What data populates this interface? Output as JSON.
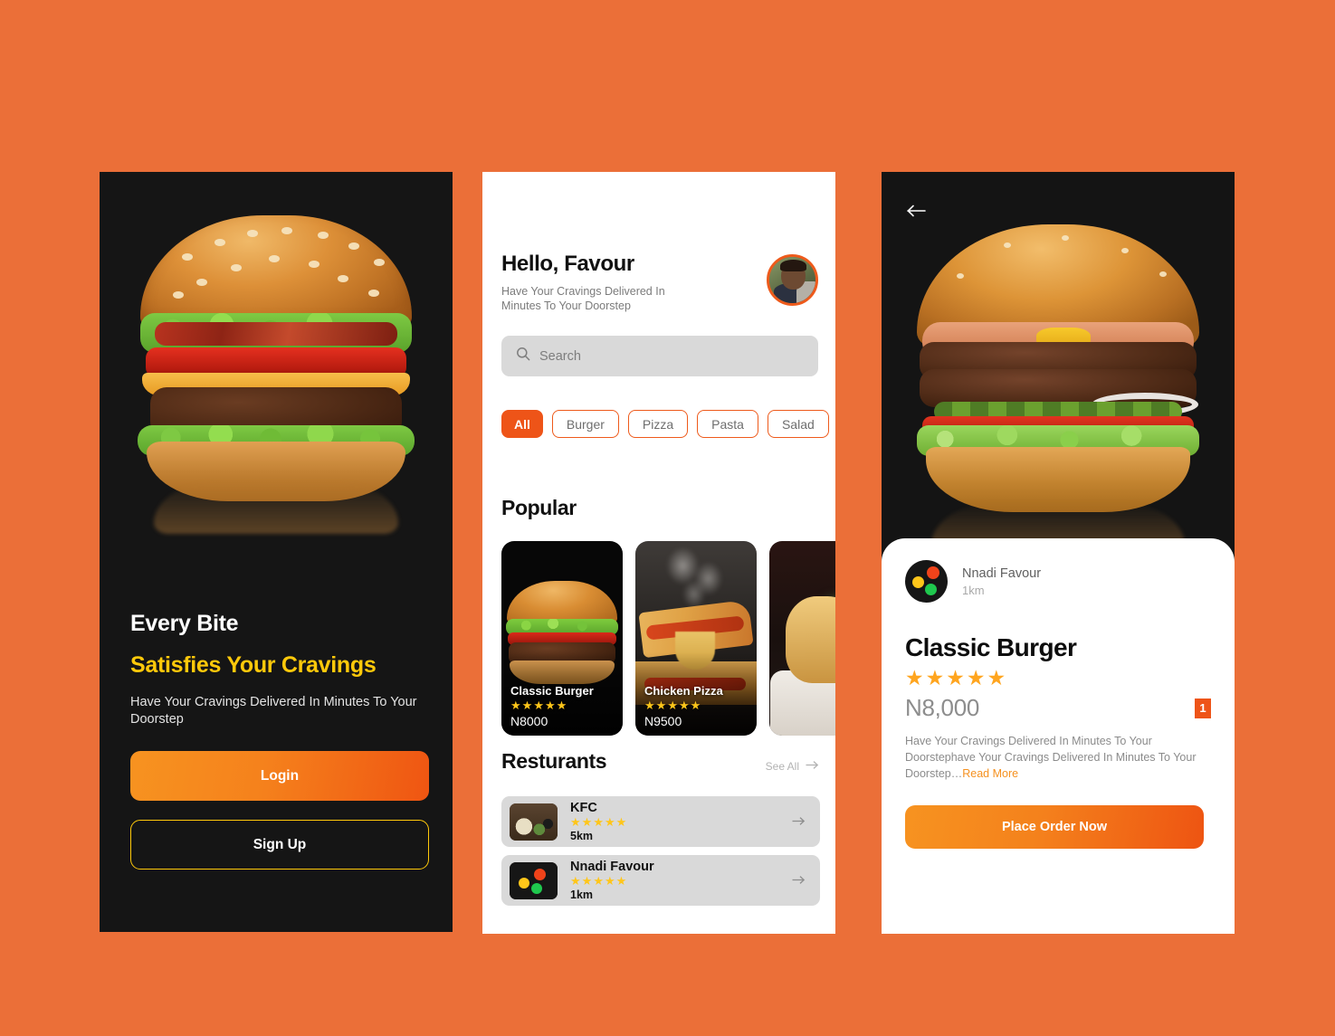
{
  "theme": {
    "page_background": "#EB6F38",
    "accent_orange": "#EE5418",
    "accent_yellow": "#FFC90A",
    "star_color": "#FFC61A",
    "dark_panel": "#151515"
  },
  "onboarding": {
    "hero_image_alt": "classic burger on black background",
    "title": "Every Bite",
    "title_accent": "Satisfies Your Cravings",
    "subtitle": "Have Your Cravings Delivered In Minutes To Your Doorstep",
    "login_label": "Login",
    "signup_label": "Sign Up"
  },
  "home": {
    "greeting": "Hello, Favour",
    "greeting_sub": "Have Your Cravings Delivered In Minutes To Your Doorstep",
    "avatar_alt": "user profile photo",
    "search": {
      "placeholder": "Search",
      "value": "",
      "icon": "search-icon"
    },
    "categories": [
      {
        "label": "All",
        "active": true
      },
      {
        "label": "Burger",
        "active": false
      },
      {
        "label": "Pizza",
        "active": false
      },
      {
        "label": "Pasta",
        "active": false
      },
      {
        "label": "Salad",
        "active": false
      }
    ],
    "popular": {
      "title": "Popular",
      "items": [
        {
          "name": "Classic Burger",
          "price": "N8000",
          "rating": 5,
          "image_alt": "classic burger"
        },
        {
          "name": "Chicken Pizza",
          "price": "N9500",
          "rating": 5,
          "image_alt": "chicken pizza with steam"
        },
        {
          "name": "",
          "price": "",
          "rating": 0,
          "image_alt": "cheesy pasta in bowl"
        }
      ]
    },
    "restaurants": {
      "title": "Resturants",
      "see_all_label": "See All",
      "see_all_icon": "arrow-right-icon",
      "items": [
        {
          "name": "KFC",
          "distance": "5km",
          "rating": 5,
          "logo_type": "photo",
          "image_alt": "plated food photo"
        },
        {
          "name": "Nnadi Favour",
          "distance": "1km",
          "rating": 5,
          "logo_type": "dots",
          "image_alt": "three colored dots logo"
        }
      ]
    }
  },
  "detail": {
    "back_icon": "arrow-left-icon",
    "hero_image_alt": "classic burger close up on black background",
    "vendor": {
      "name": "Nnadi Favour",
      "distance": "1km",
      "logo_type": "dots"
    },
    "title": "Classic Burger",
    "rating": 5,
    "price": "N8,000",
    "quantity_badge": "1",
    "description": "Have Your Cravings Delivered In Minutes To Your Doorstephave Your Cravings Delivered In Minutes To Your Doorstep",
    "description_ellipsis": "…",
    "read_more_label": "Read More",
    "order_button_label": "Place Order Now"
  }
}
